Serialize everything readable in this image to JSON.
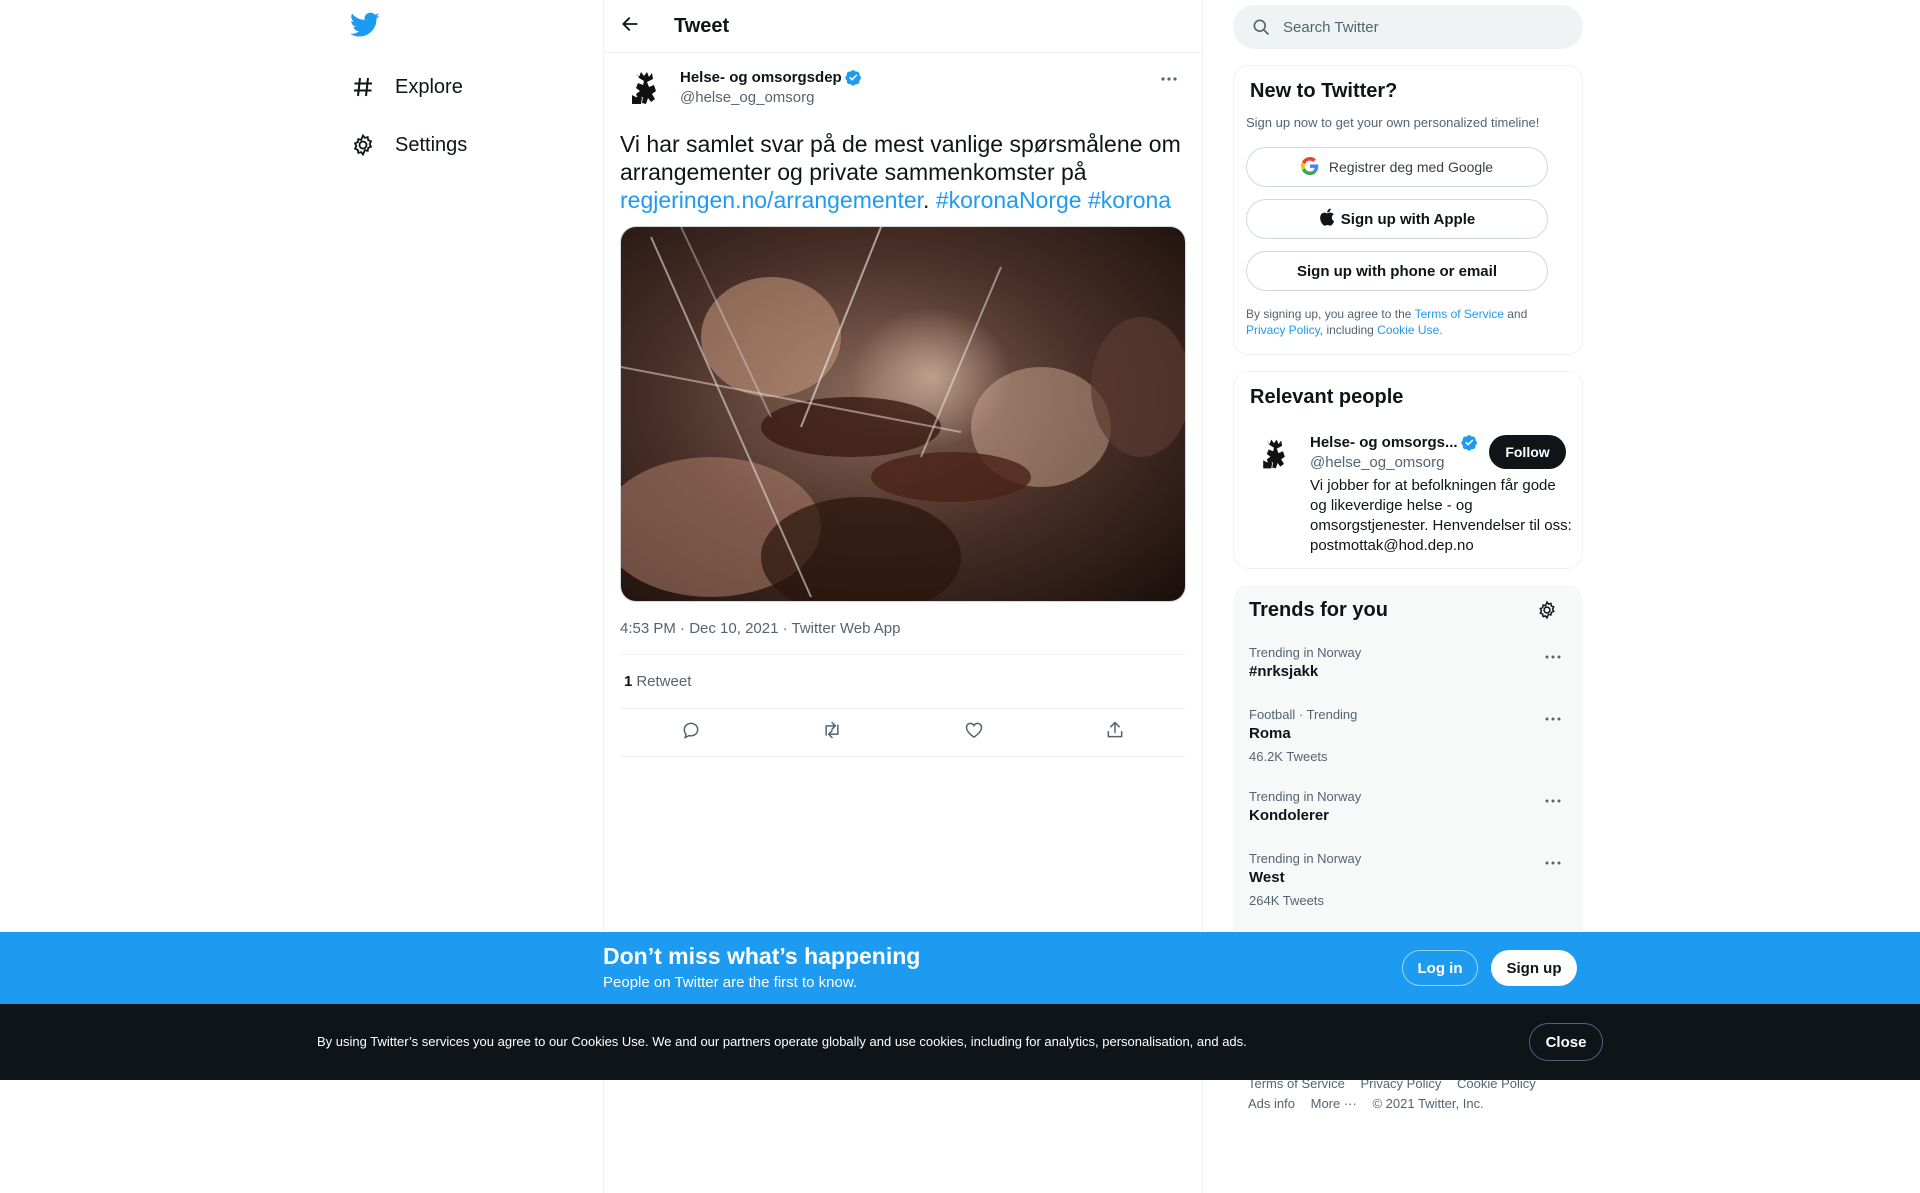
{
  "nav": {
    "logo_icon": "twitter-bird-icon",
    "items": [
      {
        "label": "Explore",
        "icon": "hashtag-icon"
      },
      {
        "label": "Settings",
        "icon": "gear-icon"
      }
    ]
  },
  "header": {
    "back_icon": "arrow-left-icon",
    "title": "Tweet"
  },
  "tweet": {
    "author_name": "Helse- og omsorgsdep",
    "author_handle": "@helse_og_omsorg",
    "text_plain": "Vi har samlet svar på de mest vanlige spørsmålene om arrangementer og private sammenkomster på ",
    "link": "regjeringen.no/arrangementer",
    "separator": ". ",
    "hashtag1": "#koronaNorge",
    "hashtag2": "#korona",
    "time": "4:53 PM",
    "dot1": " · ",
    "date": "Dec 10, 2021",
    "dot2": " · ",
    "source": "Twitter Web App",
    "retweet_count": "1",
    "retweet_label": "Retweet"
  },
  "search": {
    "placeholder": "Search Twitter"
  },
  "signup": {
    "title": "New to Twitter?",
    "subtitle": "Sign up now to get your own personalized timeline!",
    "google_label": "Registrer deg med Google",
    "apple_label": "Sign up with Apple",
    "phone_label": "Sign up with phone or email",
    "legal_1": "By signing up, you agree to the ",
    "terms": "Terms of Service",
    "legal_2": " and ",
    "privacy": "Privacy Policy",
    "legal_3": ", including ",
    "cookie": "Cookie Use."
  },
  "people": {
    "title": "Relevant people",
    "name": "Helse- og omsorgs...",
    "handle": "@helse_og_omsorg",
    "follow_label": "Follow",
    "bio": "Vi jobber for at befolkningen får gode og likeverdige helse - og omsorgstjenester. Henvendelser til oss: postmottak@hod.dep.no"
  },
  "trends": {
    "title": "Trends for you",
    "items": [
      {
        "context": "Trending in Norway",
        "name": "#nrksjakk",
        "count": ""
      },
      {
        "context": "Football · Trending",
        "name": "Roma",
        "count": "46.2K Tweets"
      },
      {
        "context": "Trending in Norway",
        "name": "Kondolerer",
        "count": ""
      },
      {
        "context": "Trending in Norway",
        "name": "West",
        "count": "264K Tweets"
      }
    ]
  },
  "footer": {
    "terms": "Terms of Service",
    "privacy": "Privacy Policy",
    "cookie": "Cookie Policy",
    "ads": "Ads info",
    "more": "More ···",
    "copyright": "© 2021 Twitter, Inc."
  },
  "login_banner": {
    "title": "Don’t miss what’s happening",
    "subtitle": "People on Twitter are the first to know.",
    "login_label": "Log in",
    "signup_label": "Sign up"
  },
  "cookie_banner": {
    "text": "By using Twitter’s services you agree to our Cookies Use. We and our partners operate globally and use cookies, including for analytics, personalisation, and ads.",
    "close_label": "Close"
  },
  "colors": {
    "accent": "#1d9bf0",
    "text": "#0f1419",
    "muted": "#536471"
  }
}
